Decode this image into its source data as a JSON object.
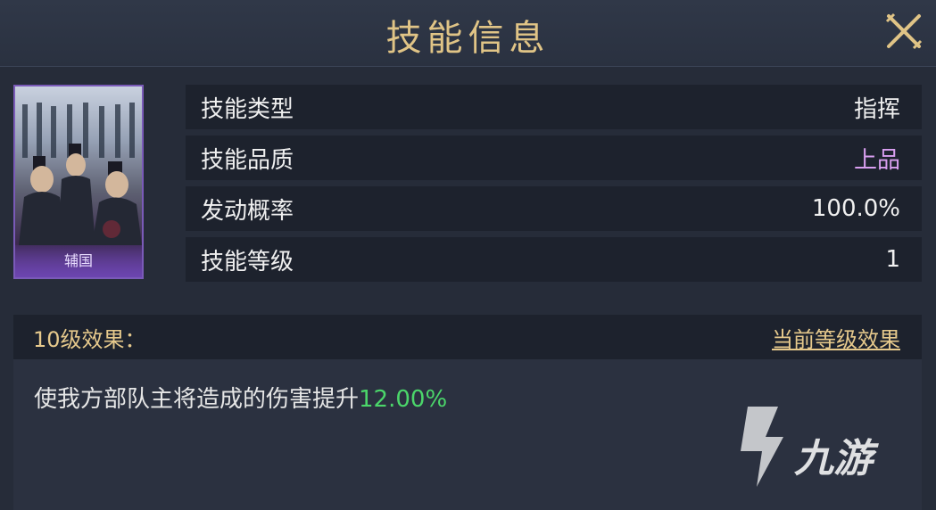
{
  "header": {
    "title": "技能信息"
  },
  "card": {
    "name": "辅国"
  },
  "attributes": [
    {
      "label": "技能类型",
      "value": "指挥"
    },
    {
      "label": "技能品质",
      "value": "上品"
    },
    {
      "label": "发动概率",
      "value": "100.0%"
    },
    {
      "label": "技能等级",
      "value": "1"
    }
  ],
  "effect": {
    "title": "10级效果：",
    "link": "当前等级效果",
    "text": "使我方部队主将造成的伤害提升",
    "highlight": "12.00%"
  },
  "watermark": {
    "text": "九游"
  },
  "colors": {
    "gold": "#e6c98c",
    "quality": "#d99ff0",
    "highlight": "#4bd66a",
    "background": "#262c39"
  }
}
